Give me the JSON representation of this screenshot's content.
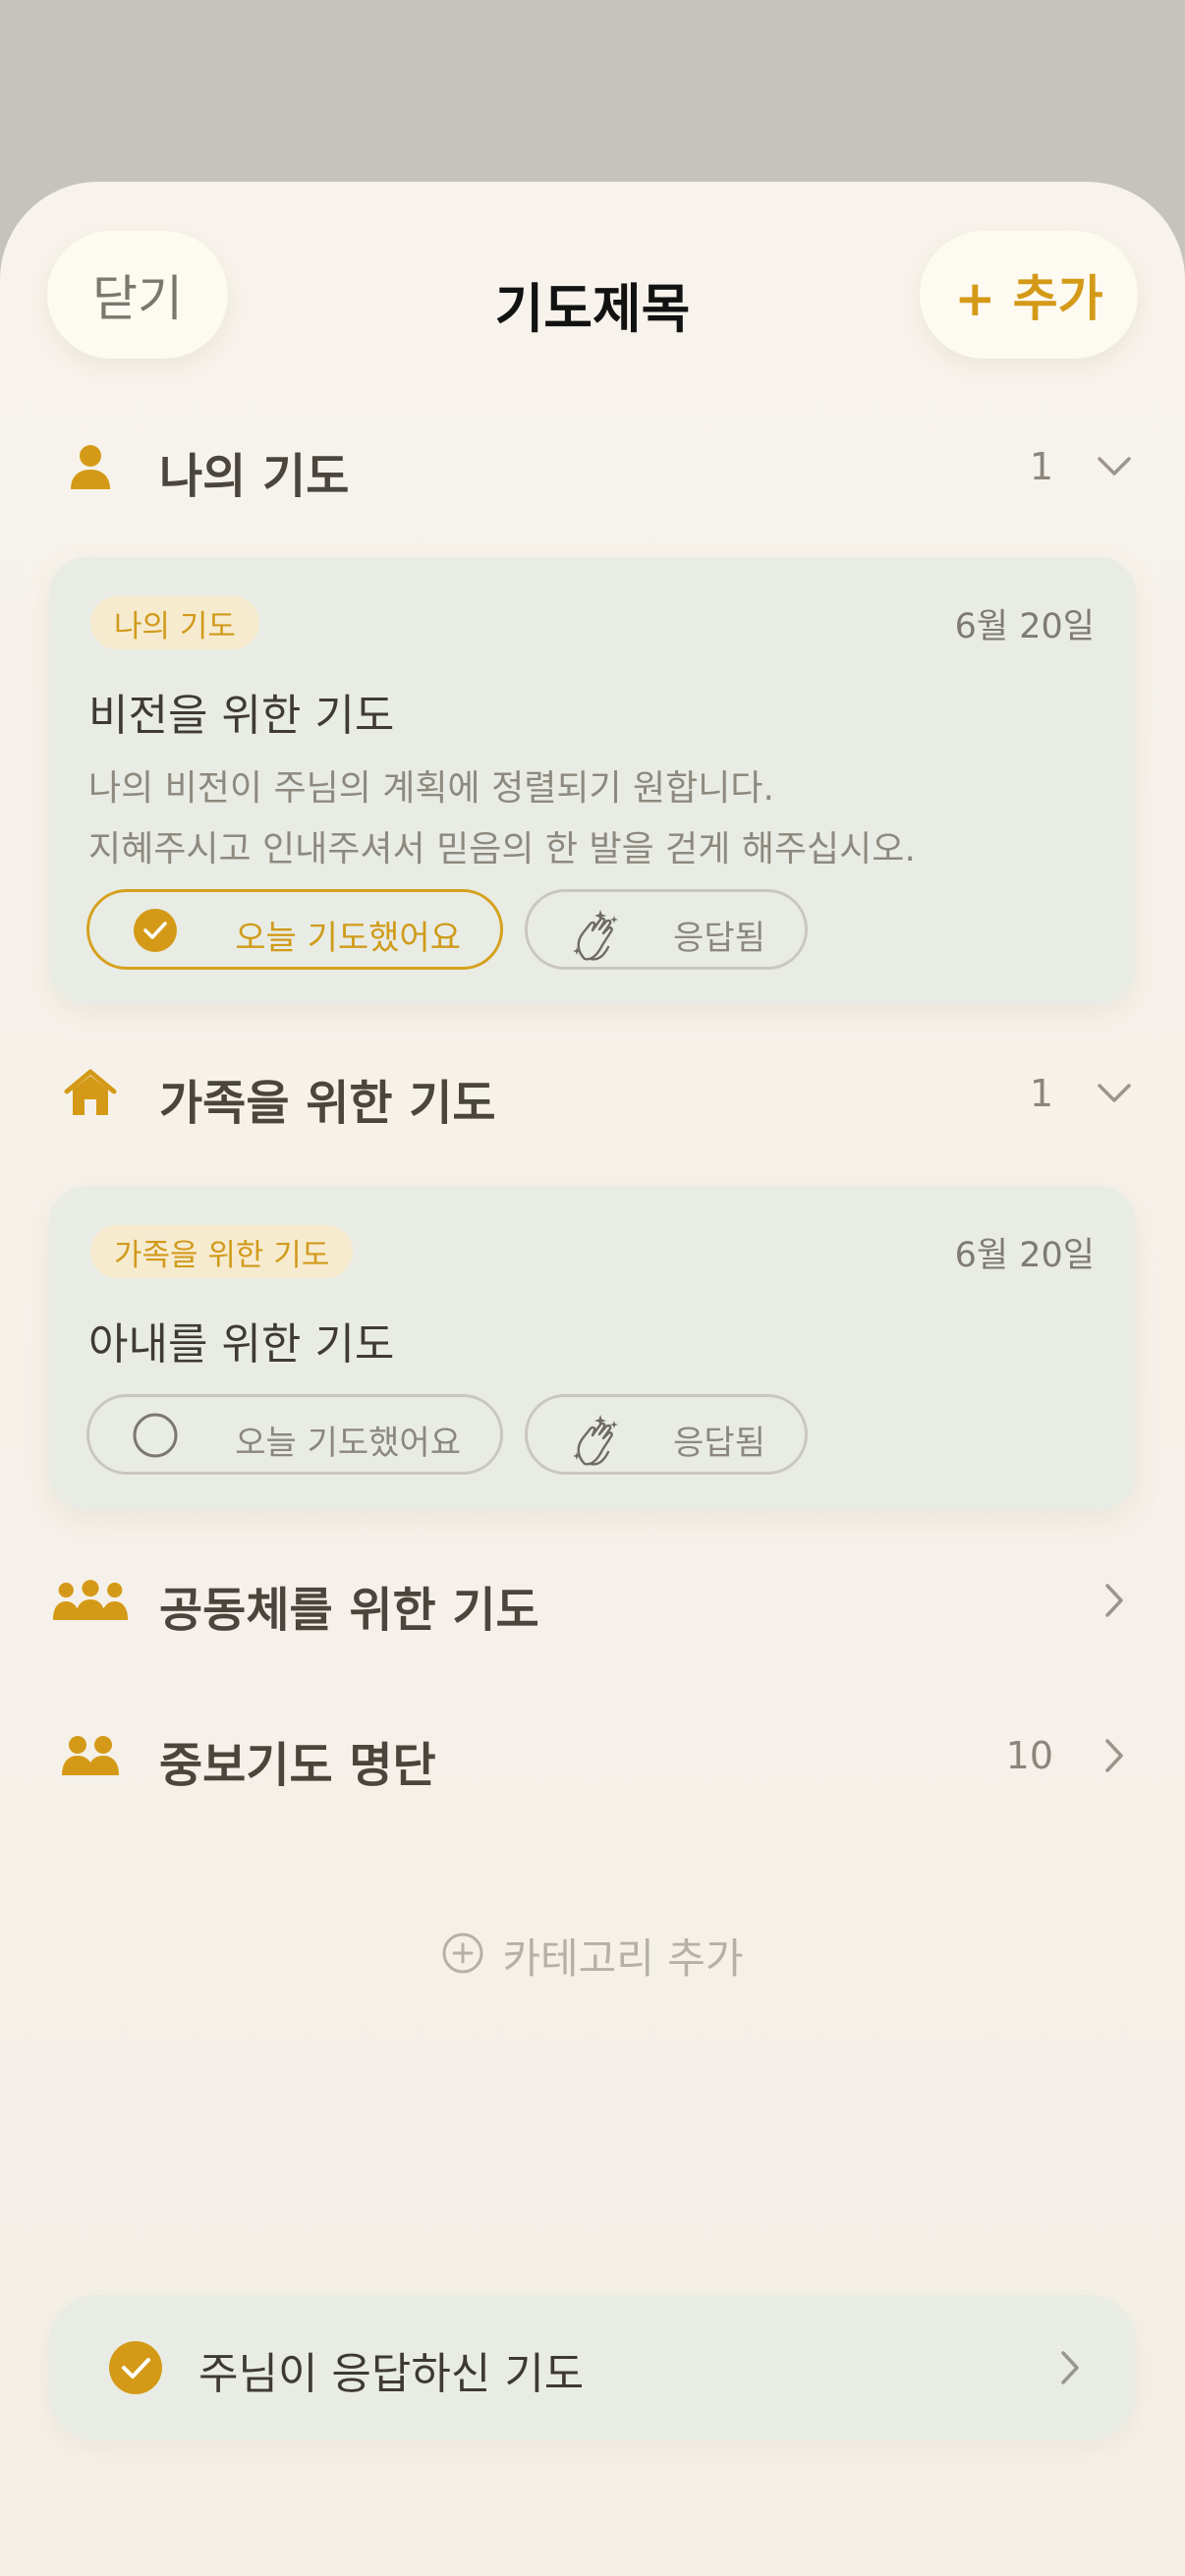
{
  "header": {
    "close_label": "닫기",
    "title": "기도제목",
    "add_label": "+ 추가"
  },
  "sections": [
    {
      "label": "나의 기도",
      "count": "1",
      "icon": "person-icon",
      "expanded": true
    },
    {
      "label": "가족을 위한 기도",
      "count": "1",
      "icon": "home-icon",
      "expanded": true
    },
    {
      "label": "공동체를 위한 기도",
      "count": "",
      "icon": "group-icon",
      "expanded": false
    },
    {
      "label": "중보기도 명단",
      "count": "10",
      "icon": "people-icon",
      "expanded": false
    }
  ],
  "cards": [
    {
      "tag": "나의 기도",
      "date": "6월 20일",
      "title": "비전을 위한 기도",
      "desc_lines": [
        "나의 비전이 주님의 계획에 정렬되기 원합니다.",
        "지혜주시고 인내주셔서 믿음의 한 발을 걷게 해주십시오."
      ],
      "prayed_label": "오늘 기도했어요",
      "prayed_today": true,
      "answered_label": "응답됨"
    },
    {
      "tag": "가족을 위한 기도",
      "date": "6월 20일",
      "title": "아내를 위한 기도",
      "prayed_label": "오늘 기도했어요",
      "prayed_today": false,
      "answered_label": "응답됨"
    }
  ],
  "add_category_label": "카테고리 추가",
  "answered_bar": {
    "label": "주님이 응답하신 기도"
  },
  "colors": {
    "accent": "#D49A17",
    "card_bg": "#E9ECE4",
    "sheet_bg": "#F5F1EA",
    "backdrop": "#C6C3BD"
  }
}
